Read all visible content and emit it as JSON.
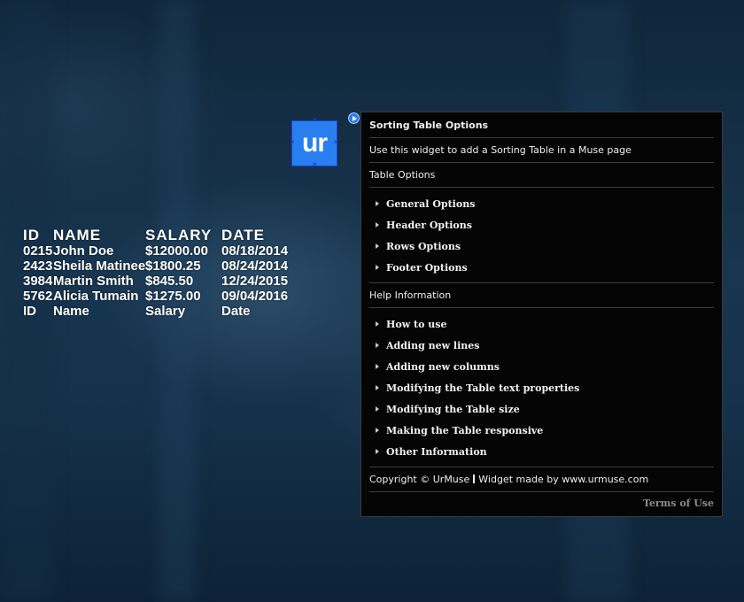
{
  "table": {
    "header": [
      "ID",
      "NAME",
      "SALARY",
      "DATE"
    ],
    "rows": [
      [
        "0215",
        "John Doe",
        "$12000.00",
        "08/18/2014"
      ],
      [
        "2423",
        "Sheila Matinee",
        "$1800.25",
        "08/24/2014"
      ],
      [
        "3984",
        "Martin Smith",
        "$845.50",
        "12/24/2015"
      ],
      [
        "5762",
        "Alicia Tumain",
        "$1275.00",
        "09/04/2016"
      ]
    ],
    "footer": [
      "ID",
      "Name",
      "Salary",
      "Date"
    ]
  },
  "widget": {
    "icon_text": "ur",
    "icon": "play-icon",
    "accent": "#2a7ff0"
  },
  "panel": {
    "title": "Sorting Table Options",
    "description": "Use this widget to add a Sorting Table in a Muse page",
    "table_options_heading": "Table Options",
    "table_options": [
      "General Options",
      "Header Options",
      "Rows Options",
      "Footer Options"
    ],
    "help_heading": "Help Information",
    "help_items": [
      "How to use",
      "Adding new lines",
      "Adding new columns",
      "Modifying the Table text properties",
      "Modifying the Table size",
      "Making the Table responsive",
      "Other Information"
    ],
    "copyright": "Copyright © UrMuse",
    "credit": "Widget made by www.urmuse.com",
    "terms": "Terms of Use"
  }
}
